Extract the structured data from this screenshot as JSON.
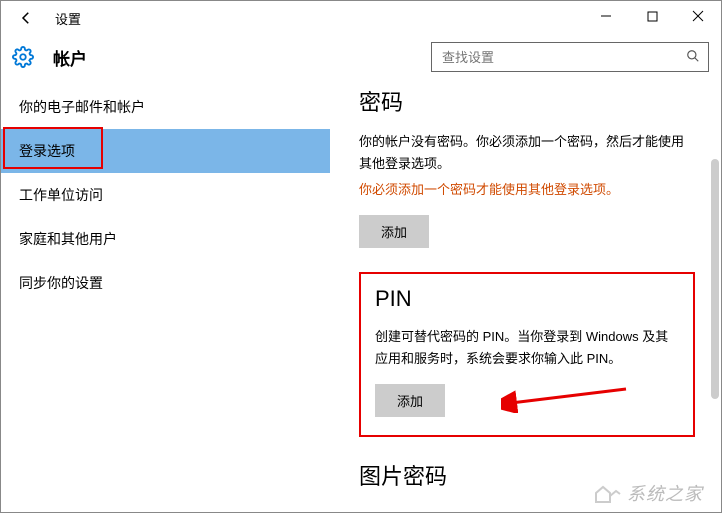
{
  "window": {
    "title": "设置",
    "category": "帐户"
  },
  "search": {
    "placeholder": "查找设置"
  },
  "sidebar": {
    "items": [
      {
        "label": "你的电子邮件和帐户"
      },
      {
        "label": "登录选项"
      },
      {
        "label": "工作单位访问"
      },
      {
        "label": "家庭和其他用户"
      },
      {
        "label": "同步你的设置"
      }
    ]
  },
  "password": {
    "heading": "密码",
    "desc": "你的帐户没有密码。你必须添加一个密码，然后才能使用其他登录选项。",
    "warn": "你必须添加一个密码才能使用其他登录选项。",
    "button": "添加"
  },
  "pin": {
    "heading": "PIN",
    "desc": "创建可替代密码的 PIN。当你登录到 Windows 及其应用和服务时，系统会要求你输入此 PIN。",
    "button": "添加"
  },
  "picture": {
    "heading": "图片密码"
  },
  "watermark": "系统之家"
}
